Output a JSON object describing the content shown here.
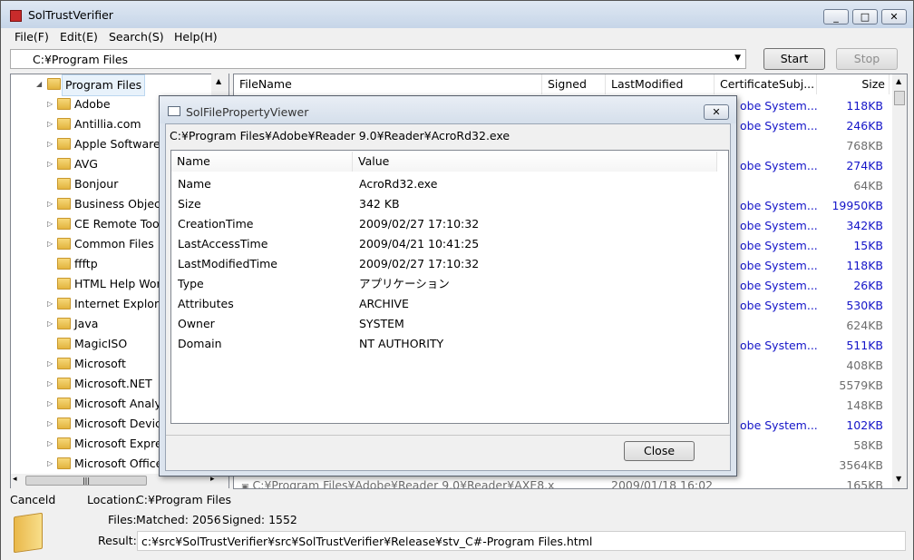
{
  "window": {
    "title": "SolTrustVerifier"
  },
  "menu": [
    "File(F)",
    "Edit(E)",
    "Search(S)",
    "Help(H)"
  ],
  "path_combo": {
    "value": "C:¥Program Files"
  },
  "buttons": {
    "start": "Start",
    "stop": "Stop",
    "close": "Close"
  },
  "tree": {
    "root": "Program Files",
    "items": [
      "Adobe",
      "Antillia.com",
      "Apple Software",
      "AVG",
      "Bonjour",
      "Business Object",
      "CE Remote Tool",
      "Common Files",
      "ffftp",
      "HTML Help Worl",
      "Internet Explore",
      "Java",
      "MagicISO",
      "Microsoft",
      "Microsoft.NET",
      "Microsoft Analys",
      "Microsoft Device",
      "Microsoft Expres",
      "Microsoft Office"
    ],
    "expandable": [
      true,
      true,
      true,
      true,
      false,
      true,
      true,
      true,
      false,
      false,
      true,
      true,
      false,
      true,
      true,
      true,
      true,
      true,
      true
    ]
  },
  "list": {
    "columns": [
      "FileName",
      "Signed",
      "LastModified",
      "CertificateSubj...",
      "Size"
    ],
    "rows": [
      {
        "subj": "obe System...",
        "size": "118KB",
        "blue": true
      },
      {
        "subj": "obe System...",
        "size": "246KB",
        "blue": true
      },
      {
        "subj": "",
        "size": "768KB",
        "blue": false
      },
      {
        "subj": "obe System...",
        "size": "274KB",
        "blue": true
      },
      {
        "subj": "",
        "size": "64KB",
        "blue": false
      },
      {
        "subj": "obe System...",
        "size": "19950KB",
        "blue": true
      },
      {
        "subj": "obe System...",
        "size": "342KB",
        "blue": true
      },
      {
        "subj": "obe System...",
        "size": "15KB",
        "blue": true
      },
      {
        "subj": "obe System...",
        "size": "118KB",
        "blue": true
      },
      {
        "subj": "obe System...",
        "size": "26KB",
        "blue": true
      },
      {
        "subj": "obe System...",
        "size": "530KB",
        "blue": true
      },
      {
        "subj": "",
        "size": "624KB",
        "blue": false
      },
      {
        "subj": "obe System...",
        "size": "511KB",
        "blue": true
      },
      {
        "subj": "",
        "size": "408KB",
        "blue": false
      },
      {
        "subj": "",
        "size": "5579KB",
        "blue": false
      },
      {
        "subj": "",
        "size": "148KB",
        "blue": false
      },
      {
        "subj": "obe System...",
        "size": "102KB",
        "blue": true
      },
      {
        "subj": "",
        "size": "58KB",
        "blue": false
      },
      {
        "subj": "",
        "size": "3564KB",
        "blue": false
      }
    ],
    "last_row": {
      "filename": "C:¥Program Files¥Adobe¥Reader 9.0¥Reader¥AXE8...",
      "signed": "x",
      "modified": "2009/01/18 16:02",
      "size": "165KB"
    }
  },
  "status": {
    "state": "Canceld",
    "location_label": "Location:",
    "location": "C:¥Program Files",
    "files_label": "Files:",
    "matched": "Matched: 2056",
    "signed": "Signed: 1552",
    "result_label": "Result:",
    "result": "c:¥src¥SolTrustVerifier¥src¥SolTrustVerifier¥Release¥stv_C#-Program Files.html"
  },
  "dialog": {
    "title": "SolFilePropertyViewer",
    "path": "C:¥Program Files¥Adobe¥Reader 9.0¥Reader¥AcroRd32.exe",
    "columns": [
      "Name",
      "Value"
    ],
    "rows": [
      {
        "name": "Name",
        "value": "AcroRd32.exe"
      },
      {
        "name": "Size",
        "value": "342 KB"
      },
      {
        "name": "CreationTime",
        "value": "2009/02/27 17:10:32"
      },
      {
        "name": "LastAccessTime",
        "value": "2009/04/21 10:41:25"
      },
      {
        "name": "LastModifiedTime",
        "value": "2009/02/27 17:10:32"
      },
      {
        "name": "Type",
        "value": "アプリケーション"
      },
      {
        "name": "Attributes",
        "value": "ARCHIVE"
      },
      {
        "name": "Owner",
        "value": "SYSTEM"
      },
      {
        "name": "Domain",
        "value": "NT AUTHORITY"
      }
    ]
  }
}
